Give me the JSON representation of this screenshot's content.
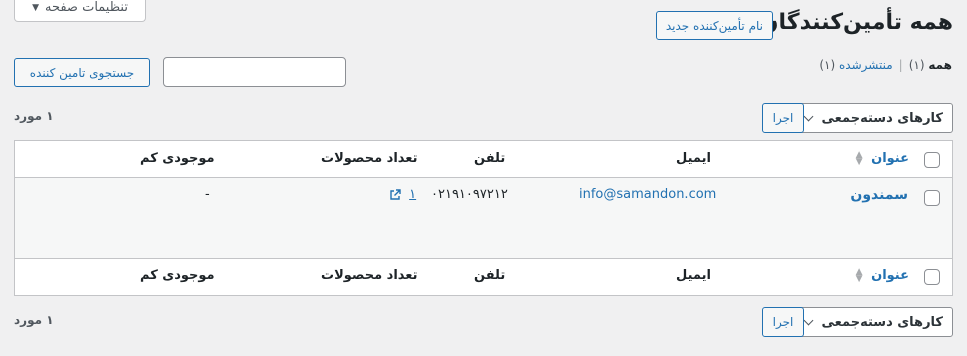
{
  "screen_options": {
    "label": "تنظیمات صفحه"
  },
  "header": {
    "title": "همه تأمین‌کنندگان",
    "add_new": "نام تأمین‌کننده جدید"
  },
  "views": {
    "all_label": "همه",
    "all_count": "(۱)",
    "separator": "|",
    "published_label": "منتشرشده",
    "published_count": "(۱)"
  },
  "search": {
    "button": "جستجوی تامین کننده",
    "value": ""
  },
  "tablenav": {
    "bulk_actions": "کارهای دسته‌جمعی",
    "apply": "اجرا",
    "items_count": "۱ مورد"
  },
  "table": {
    "columns": {
      "title": "عنوان",
      "email": "ایمیل",
      "phone": "تلفن",
      "product_count": "تعداد محصولات",
      "low_stock": "موجودی کم"
    },
    "rows": [
      {
        "title": "سمندون",
        "email": "info@samandon.com",
        "phone": "۰۲۱۹۱۰۹۷۲۱۲",
        "product_count": "۱",
        "low_stock": "-"
      }
    ]
  },
  "icons": {
    "sort": "sort-arrows-icon",
    "external": "external-link-icon",
    "dropdown": "chevron-down-icon"
  },
  "colors": {
    "link": "#2271b1",
    "background": "#f0f0f1"
  }
}
